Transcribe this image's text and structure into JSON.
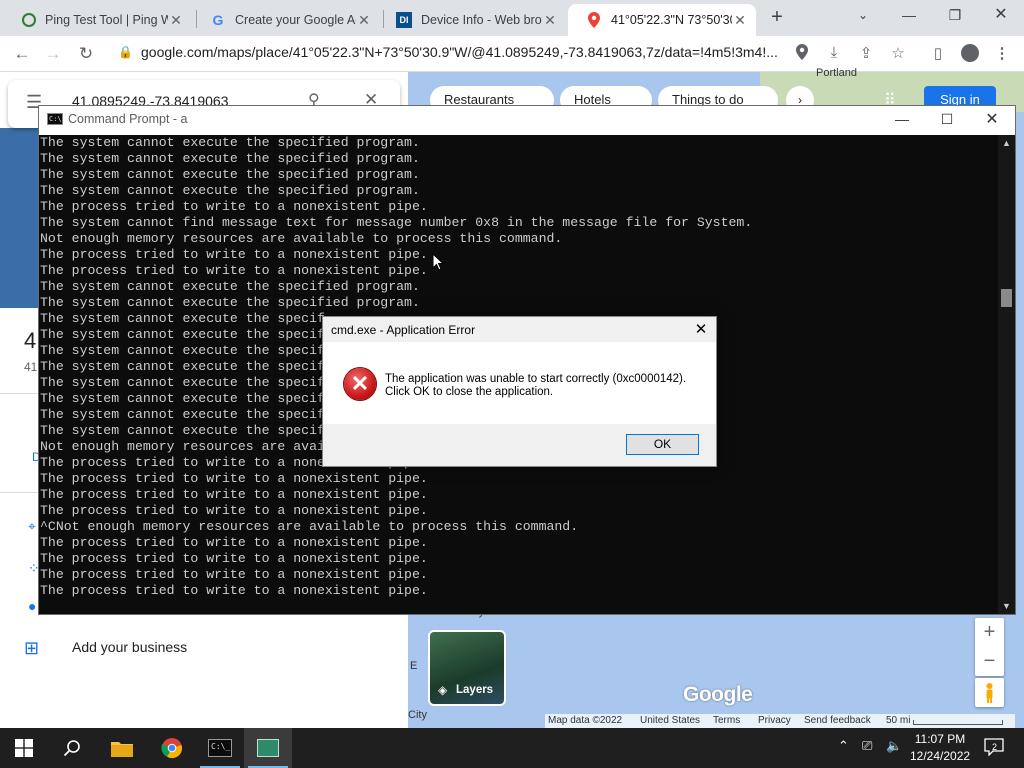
{
  "browser": {
    "tabs": [
      {
        "title": "Ping Test Tool | Ping W",
        "favicon": "ping-favicon",
        "active": false
      },
      {
        "title": "Create your Google Ac",
        "favicon": "google-favicon",
        "active": false
      },
      {
        "title": "Device Info - Web brow",
        "favicon": "device-info-favicon",
        "active": false
      },
      {
        "title": "41°05'22.3\"N 73°50'30",
        "favicon": "maps-favicon",
        "active": true
      }
    ],
    "url": "google.com/maps/place/41°05'22.3\"N+73°50'30.9\"W/@41.0895249,-73.8419063,7z/data=!4m5!3m4!...",
    "accent": "#1a73e8"
  },
  "maps": {
    "search_value": "41.0895249,-73.8419063",
    "chips": [
      "Restaurants",
      "Hotels",
      "Things to do"
    ],
    "sign_in": "Sign in",
    "city_portland": "Portland",
    "city_atlantic": "Atlantic City",
    "city_edge": "City",
    "panel_heading": "41",
    "panel_sub": "41",
    "panel_letter": "D",
    "add_business": "Add your business",
    "layers_label": "Layers",
    "logo": "Google",
    "footer": {
      "map_data": "Map data ©2022",
      "country": "United States",
      "terms": "Terms",
      "privacy": "Privacy",
      "feedback": "Send feedback",
      "scale": "50 mi"
    },
    "zoom_in": "+",
    "zoom_out": "−"
  },
  "cmd": {
    "title": "Command Prompt - a",
    "lines": [
      "The system cannot execute the specified program.",
      "The system cannot execute the specified program.",
      "The system cannot execute the specified program.",
      "The system cannot execute the specified program.",
      "The process tried to write to a nonexistent pipe.",
      "The system cannot find message text for message number 0x8 in the message file for System.",
      "Not enough memory resources are available to process this command.",
      "The process tried to write to a nonexistent pipe.",
      "The process tried to write to a nonexistent pipe.",
      "The system cannot execute the specified program.",
      "The system cannot execute the specified program.",
      "The system cannot execute the specif",
      "The system cannot execute the specif",
      "The system cannot execute the specif",
      "The system cannot execute the specif",
      "The system cannot execute the specif",
      "The system cannot execute the specif",
      "The system cannot execute the specif",
      "The system cannot execute the specif",
      "Not enough memory resources are avai",
      "The process tried to write to a nonexistent pipe.",
      "The process tried to write to a nonexistent pipe.",
      "The process tried to write to a nonexistent pipe.",
      "The process tried to write to a nonexistent pipe.",
      "^CNot enough memory resources are available to process this command.",
      "The process tried to write to a nonexistent pipe.",
      "The process tried to write to a nonexistent pipe.",
      "The process tried to write to a nonexistent pipe.",
      "The process tried to write to a nonexistent pipe."
    ]
  },
  "dialog": {
    "title": "cmd.exe - Application Error",
    "message_line1": "The application was unable to start correctly (0xc0000142).",
    "message_line2": "Click OK to close the application.",
    "ok": "OK",
    "icon": "error-icon"
  },
  "taskbar": {
    "time": "11:07 PM",
    "date": "12/24/2022",
    "notifications": "2",
    "apps": [
      "start-button",
      "search-button",
      "file-explorer",
      "chrome",
      "command-prompt",
      "active-app"
    ]
  }
}
